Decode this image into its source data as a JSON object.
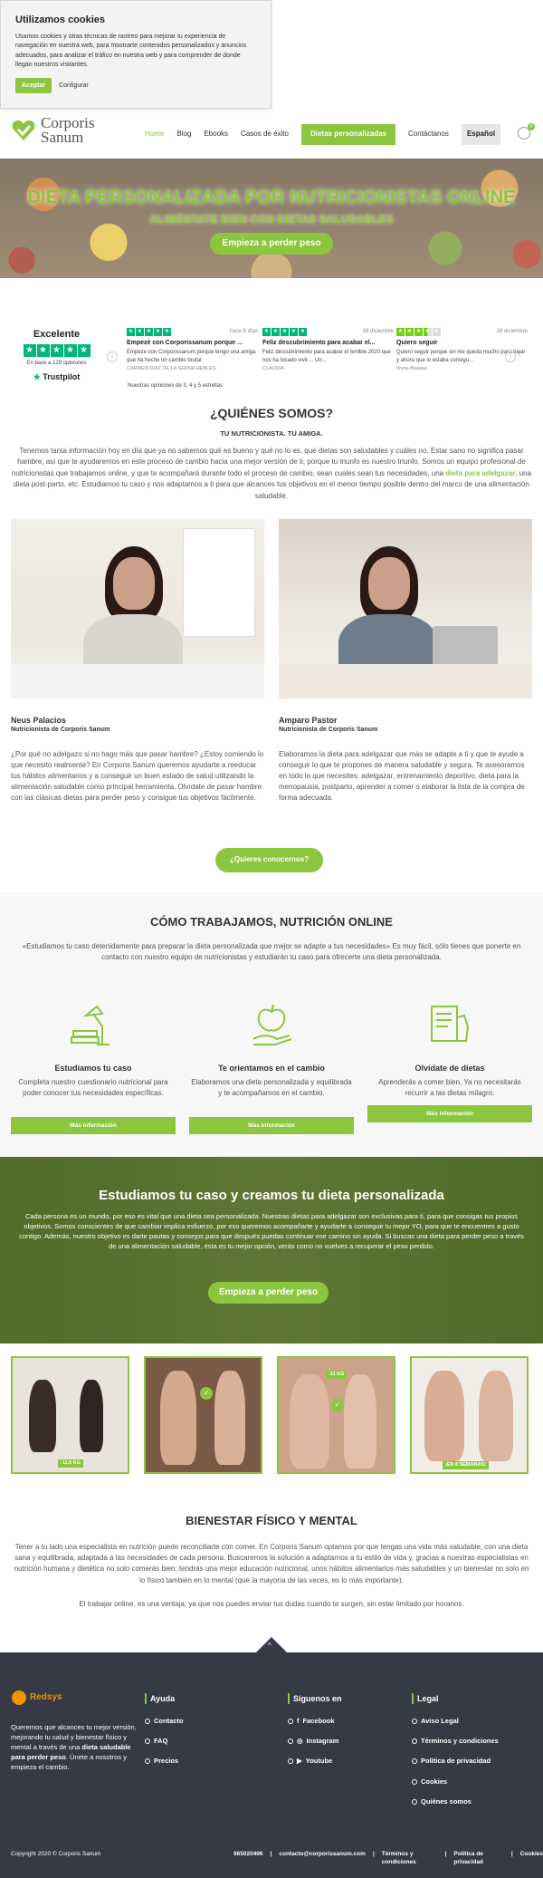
{
  "cookie": {
    "title": "Utilizamos cookies",
    "text": "Usamos cookies y otras técnicas de rastreo para mejorar tu experiencia de navegación en nuestra web, para mostrarte contenidos personalizados y anuncios adecuados, para analizar el tráfico en nuestra web y para comprender de donde llegan nuestros visitantes.",
    "accept_label": "Aceptar",
    "config_label": "Configurar"
  },
  "brand": {
    "line1": "Corporis",
    "line2": "Sanum",
    "accent": "#8cc63f"
  },
  "nav": {
    "items": [
      "Home",
      "Blog",
      "Ebooks",
      "Casos de éxito"
    ],
    "dietas": "Dietas personalizadas",
    "contact": "Contáctanos",
    "lang": "Español",
    "cart_count": "0"
  },
  "hero": {
    "title": "DIETA PERSONALIZADA POR NUTRICIONISTAS ONLINE",
    "subtitle": "ALIMÉNTATE BIEN CON DIETAS SALUDABLES",
    "cta": "Empieza a perder peso"
  },
  "trustpilot": {
    "title": "Excelente",
    "basis": "En base a 129 opiniones",
    "logo": "Trustpilot",
    "note": "Nuestras opiniones de 3, 4 y 5 estrellas",
    "reviews": [
      {
        "date": "hace 6 días",
        "title": "Empezé con Corporissanum porque ...",
        "body": "Empeze con Corporissanum porque tengo una amiga que ha hecho un cambio brutal",
        "author": "CARMEN DIAZ DE LA SERNA HEBLES"
      },
      {
        "date": "28 diciembre",
        "title": "Feliz descubrimiento para acabar el...",
        "body": "Feliz descubrimiento para acabar el terrible 2020 que nos ha tocado vivir.... Un...",
        "author": "CLAUDIA"
      },
      {
        "date": "28 diciembre",
        "title": "Quiero seguir",
        "body": "Quiero seguir porque sin me queda mucho para bajar y ahora que lo estaba consigu...",
        "author": "Imma Boadas"
      }
    ]
  },
  "quienes": {
    "title": "¿QUIÉNES SOMOS?",
    "subtitle": "TU NUTRICIONISTA. TU AMIGA.",
    "para_a": "Tenemos tanta información hoy en día que ya no sabemos qué es bueno y qué no lo es, qué dietas son saludables y cuáles no. Estar sano no significa pasar hambre, así que te ayudaremos en este proceso de cambio hacia una mejor versión de ti, porque tu triunfo es nuestro triunfo. Somos un equipo profesional de nutricionistas que trabajamos online, y que te acompañará durante todo el proceso de cambio, sean cuales sean tus necesidades, una ",
    "para_link": "dieta para adelgazar",
    "para_b": ", una dieta post-parto, etc. Estudiamos tu caso y nos adaptamos a ti para que alcances tus objetivos en el menor tiempo posible dentro del marco de una alimentación saludable.",
    "people": [
      {
        "name": "Neus Palacios",
        "role": "Nutricionista de Corporis Sanum",
        "text": "¿Por qué no adelgazo si no hago más que pasar hambre? ¿Estoy comiendo lo que necesito realmente? En Corporis Sanum queremos ayudarte a reeducar tus hábitos alimentarios y a conseguir un buen estado de salud utilizando la alimentación saludable como principal herramienta. Olvídate de pasar hambre con las clásicas dietas para perder peso y consigue tus objetivos fácilmente."
      },
      {
        "name": "Amparo Pastor",
        "role": "Nutricionista de Corporis Sanum",
        "text": "Elaboramos la dieta para adelgazar que más se adapte a ti y que te ayude a conseguir lo que te propones de manera saludable y segura. Te asesoramos en todo lo que necesites: adelgazar, entrenamiento deportivo, dieta para la menopausia, postparto, aprender a comer o elaborar la lista de la compra de forma adecuada."
      }
    ],
    "cta": "¿Quieres conocernos?"
  },
  "como": {
    "title": "CÓMO TRABAJAMOS, NUTRICIÓN ONLINE",
    "intro": "«Estudiamos tu caso detenidamente para preparar la dieta personalizada que mejor se adapte a tus necesidades» Es muy fácil, sólo tienes que ponerte en contacto con nuestro equipo de nutricionistas y estudiarán tu caso para ofrecerte una dieta personalizada.",
    "features": [
      {
        "title": "Estudiamos tu caso",
        "text": "Completa nuestro cuestionario nutricional para poder conocer tus necesidades específicas.",
        "more": "Más información"
      },
      {
        "title": "Te orientamos en el cambio",
        "text": "Elaboramos una dieta personalizada y equilibrada y te acompañamos en el cambio.",
        "more": "Más información"
      },
      {
        "title": "Olvídate de dietas",
        "text": "Aprenderás a comer bien. Ya no necesitarás recurrir a las dietas milagro.",
        "more": "Más información"
      }
    ]
  },
  "band": {
    "title": "Estudiamos tu caso y creamos tu dieta personalizada",
    "text": "Cada persona es un mundo, por eso es vital que una dieta sea personalizada. Nuestras dietas para adelgazar son exclusivas para ti, para que consigas tus propios objetivos. Somos conscientes de que cambiar implica esfuerzo, por eso queremos acompañarte y ayudarte a conseguir tu mejor YO, para que te encuentres a gusto contigo. Además, nuestro objetivo es darte pautas y consejos para que después puedas continuar ese camino sin ayuda. Si buscas una dieta para perder peso a través de una alimentación saludable, ésta es tu mejor opción, verás como no vuelves a recuperar el peso perdido.",
    "cta": "Empieza a perder peso"
  },
  "before_after": {
    "tag1": "-11,5 KG",
    "tag3": "-11 KG",
    "tag4": "¡EN 8 SEMANAS!"
  },
  "bienestar": {
    "title": "BIENESTAR FÍSICO Y MENTAL",
    "text": "Tener a tu lado una especialista en nutrición puede reconciliarte con comer. En Corporis Sanum optamos por que tengas una vida más saludable, con una dieta sana y equilibrada, adaptada a las necesidades de cada persona. Buscaremos la solución a adaptarnos a tu estilo de vida y, gracias a nuestras especialistas en nutrición humana y dietética no solo comerás bien: tendrás una mejor educación nutricional, unos hábitos alimentarios más saludables y un bienestar no solo en lo físico también en lo mental (que la mayoría de las veces, es lo más importante).",
    "text2": "El trabajar online, es una ventaja, ya que nos puedes enviar tus dudas cuando te surgen, sin estar limitado por horarios."
  },
  "footer": {
    "pay_logo": "Redsys",
    "text_a": "Queremos que alcances tu mejor versión, mejorando tu salud y bienestar físico y mental a través de una ",
    "text_bold": "dieta saludable para perder peso",
    "text_b": ". Únete a nosotros y empieza el cambio.",
    "cols": [
      {
        "title": "Ayuda",
        "items": [
          "Contacto",
          "FAQ",
          "Precios"
        ]
      },
      {
        "title": "Síguenos en",
        "items": [
          "Facebook",
          "Instagram",
          "Youtube"
        ]
      },
      {
        "title": "Legal",
        "items": [
          "Aviso Legal",
          "Términos y condiciones",
          "Política de privacidad",
          "Cookies",
          "Quiénes somos"
        ]
      }
    ],
    "copyright": "Copyright 2020 © Corporis Sanum",
    "links": [
      "965020496",
      "contacto@corporissanum.com",
      "Términos y condiciones",
      "Política de privacidad",
      "Cookies"
    ]
  }
}
